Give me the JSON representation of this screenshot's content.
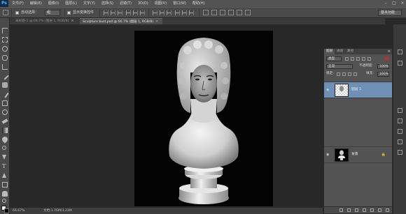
{
  "app": {
    "logo": "Ps",
    "menu": [
      "文件(F)",
      "编辑(E)",
      "图像(I)",
      "图层(L)",
      "文字(Y)",
      "选择(S)",
      "滤镜(T)",
      "3D(D)",
      "视图(V)",
      "窗口(W)",
      "帮助(H)"
    ],
    "window_controls": [
      "–",
      "□",
      "×"
    ]
  },
  "options_bar": {
    "auto_select_label": "自动选择：",
    "auto_select_value": "组",
    "show_transform_label": "显示变换控件",
    "workspace": "基本功能"
  },
  "tabs": [
    {
      "label": "未标题-1 @ 66.7% (图层 1, RGB/8)",
      "active": false
    },
    {
      "label": "Sculpture bust.psd @ 66.7% (图层 1, RGB/8)",
      "active": true
    }
  ],
  "tab_close": "×",
  "status": {
    "zoom": "66.67%",
    "doc": "文档:1.76M/3.23M"
  },
  "layers_panel": {
    "tabs": [
      "图层",
      "通道",
      "路径"
    ],
    "menu_icon": "≡",
    "filter_label": "类型",
    "blend_mode": "正常",
    "opacity_label": "不透明度:",
    "opacity_value": "100%",
    "lock_label": "锁定:",
    "fill_label": "填充:",
    "fill_value": "100%",
    "layers": [
      {
        "name": "图层 1",
        "visible": true,
        "selected": true,
        "locked": false
      },
      {
        "name": "背景",
        "visible": true,
        "selected": false,
        "locked": true
      }
    ],
    "eye_icon": "◉",
    "lock_icon": "🔒"
  },
  "colors": {
    "menubar": "#535353",
    "panel": "#535353",
    "selected_layer": "#6f8fb5",
    "canvas_bg": "#030303",
    "workspace_bg": "#282828"
  }
}
